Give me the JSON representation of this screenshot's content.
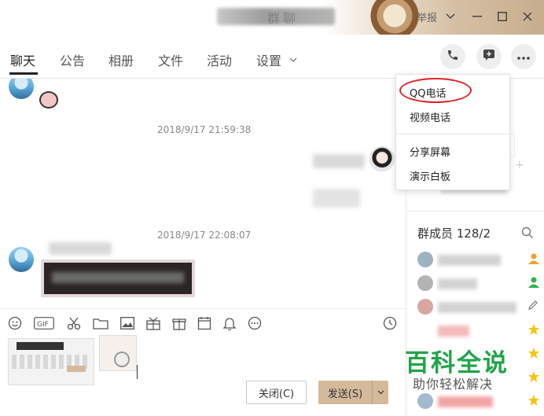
{
  "window": {
    "title": "群聊",
    "report_label": "举报",
    "brand_color": "#d4b99b"
  },
  "tabs": [
    {
      "label": "聊天",
      "active": true
    },
    {
      "label": "公告"
    },
    {
      "label": "相册"
    },
    {
      "label": "文件"
    },
    {
      "label": "活动"
    },
    {
      "label": "设置"
    }
  ],
  "header_actions": [
    {
      "icon": "phone-icon"
    },
    {
      "icon": "add-app-icon"
    },
    {
      "icon": "more-icon"
    }
  ],
  "chat": {
    "timestamps": [
      "2018/9/17 21:59:38",
      "2018/9/17 22:08:07"
    ]
  },
  "toolbar": {
    "tools": [
      "emoji-icon",
      "gif-icon",
      "scissors-icon",
      "folder-icon",
      "image-icon",
      "gift-icon",
      "present-icon",
      "calendar-icon",
      "bell-icon",
      "more-dots-icon",
      "history-clock-icon"
    ]
  },
  "input": {
    "close_label": "关闭(C)",
    "send_label": "发送(S)"
  },
  "dropdown": {
    "items": [
      "QQ电话",
      "视频电话",
      "分享屏幕",
      "演示白板"
    ],
    "highlight_color": "#e02424"
  },
  "members": {
    "header": "群成员 128/2"
  },
  "watermark": {
    "line1": "百科全说",
    "line2": "助你轻松解决",
    "color": "#22a34a"
  }
}
